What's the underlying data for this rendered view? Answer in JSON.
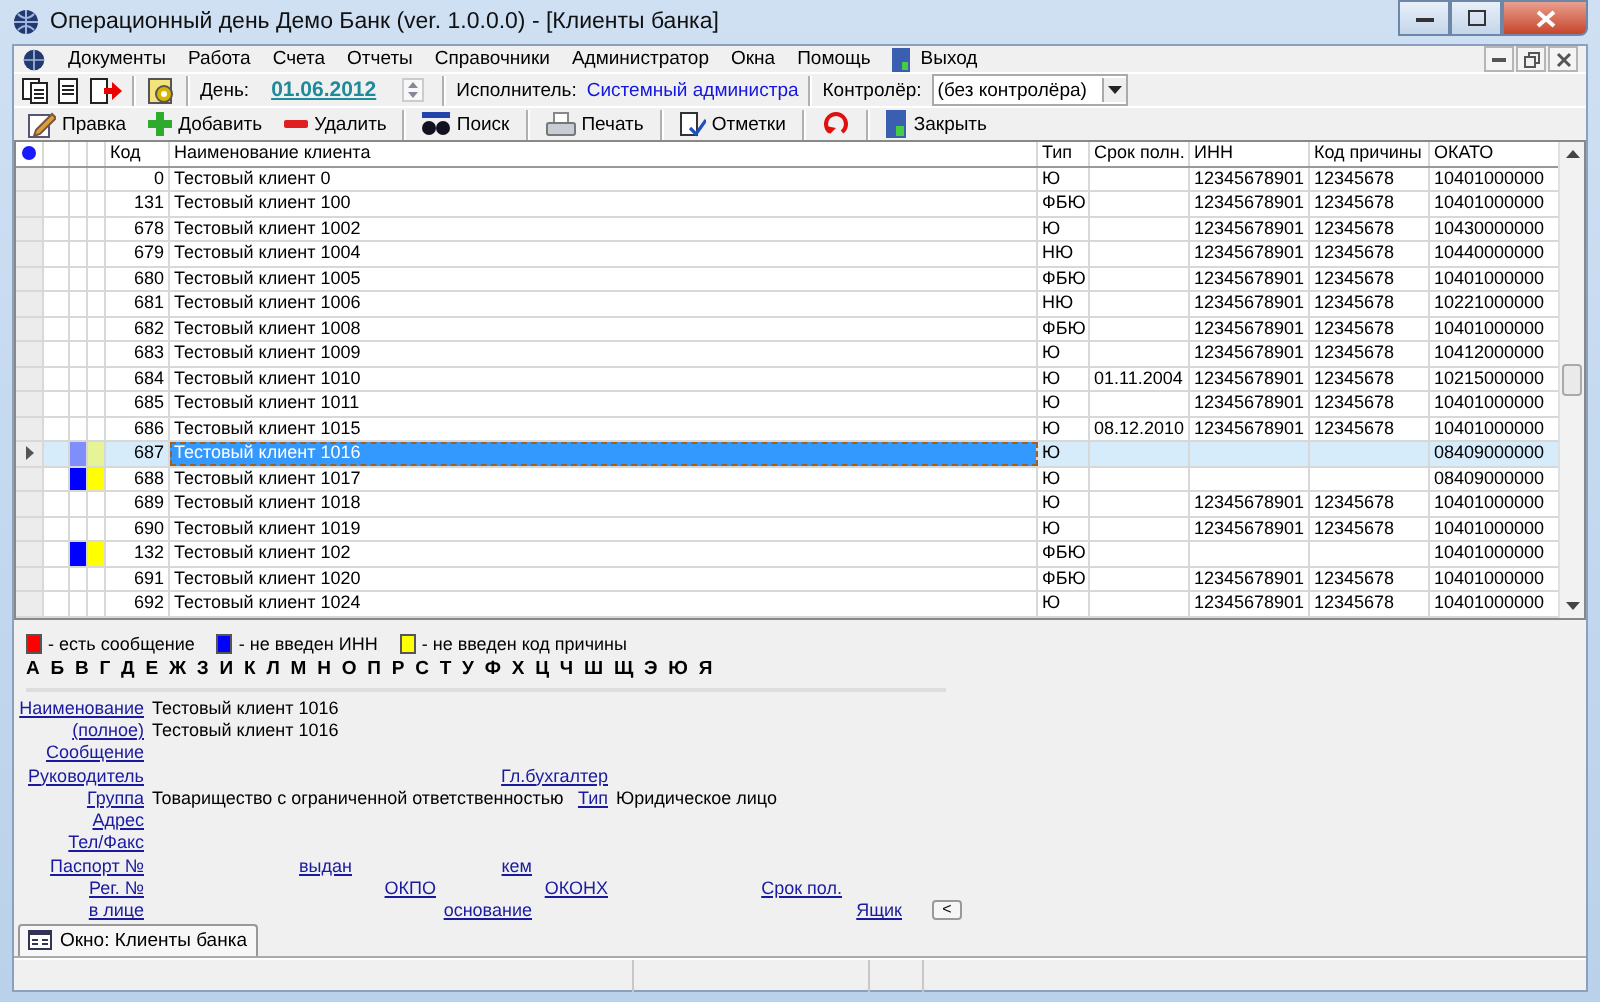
{
  "window": {
    "title": "Операционный день Демо Банк (ver. 1.0.0.0) - [Клиенты банка]"
  },
  "menu": [
    "Документы",
    "Работа",
    "Счета",
    "Отчеты",
    "Справочники",
    "Администратор",
    "Окна",
    "Помощь"
  ],
  "exit_item": "Выход",
  "toolbar": {
    "day_label": "День:",
    "date": "01.06.2012",
    "executor_label": "Исполнитель:",
    "executor": "Системный администра",
    "controller_label": "Контролёр:",
    "controller": "(без контролёра)"
  },
  "actions": [
    {
      "kind": "edit",
      "label": "Правка"
    },
    {
      "kind": "add",
      "label": "Добавить"
    },
    {
      "kind": "delete",
      "label": "Удалить"
    },
    {
      "kind": "search",
      "label": "Поиск"
    },
    {
      "kind": "print",
      "label": "Печать"
    },
    {
      "kind": "marks",
      "label": "Отметки"
    },
    {
      "kind": "refresh"
    },
    {
      "kind": "close",
      "label": "Закрыть"
    }
  ],
  "table": {
    "columns": [
      "Код",
      "Наименование клиента",
      "Тип",
      "Срок полн.",
      "ИНН",
      "Код причины",
      "ОКАТО"
    ],
    "rows": [
      {
        "code": "0",
        "name": "Тестовый клиент 0",
        "type": "Ю",
        "term": "",
        "inn": "12345678901",
        "kpp": "12345678",
        "okato": "10401000000",
        "no_inn": false,
        "no_kpp": false,
        "selected": false
      },
      {
        "code": "131",
        "name": "Тестовый клиент 100",
        "type": "ФБЮ",
        "term": "",
        "inn": "12345678901",
        "kpp": "12345678",
        "okato": "10401000000",
        "no_inn": false,
        "no_kpp": false,
        "selected": false
      },
      {
        "code": "678",
        "name": "Тестовый клиент 1002",
        "type": "Ю",
        "term": "",
        "inn": "12345678901",
        "kpp": "12345678",
        "okato": "10430000000",
        "no_inn": false,
        "no_kpp": false,
        "selected": false
      },
      {
        "code": "679",
        "name": "Тестовый клиент 1004",
        "type": "НЮ",
        "term": "",
        "inn": "12345678901",
        "kpp": "12345678",
        "okato": "10440000000",
        "no_inn": false,
        "no_kpp": false,
        "selected": false
      },
      {
        "code": "680",
        "name": "Тестовый клиент 1005",
        "type": "ФБЮ",
        "term": "",
        "inn": "12345678901",
        "kpp": "12345678",
        "okato": "10401000000",
        "no_inn": false,
        "no_kpp": false,
        "selected": false
      },
      {
        "code": "681",
        "name": "Тестовый клиент 1006",
        "type": "НЮ",
        "term": "",
        "inn": "12345678901",
        "kpp": "12345678",
        "okato": "10221000000",
        "no_inn": false,
        "no_kpp": false,
        "selected": false
      },
      {
        "code": "682",
        "name": "Тестовый клиент 1008",
        "type": "ФБЮ",
        "term": "",
        "inn": "12345678901",
        "kpp": "12345678",
        "okato": "10401000000",
        "no_inn": false,
        "no_kpp": false,
        "selected": false
      },
      {
        "code": "683",
        "name": "Тестовый клиент 1009",
        "type": "Ю",
        "term": "",
        "inn": "12345678901",
        "kpp": "12345678",
        "okato": "10412000000",
        "no_inn": false,
        "no_kpp": false,
        "selected": false
      },
      {
        "code": "684",
        "name": "Тестовый клиент 1010",
        "type": "Ю",
        "term": "01.11.2004",
        "inn": "12345678901",
        "kpp": "12345678",
        "okato": "10215000000",
        "no_inn": false,
        "no_kpp": false,
        "selected": false
      },
      {
        "code": "685",
        "name": "Тестовый клиент 1011",
        "type": "Ю",
        "term": "",
        "inn": "12345678901",
        "kpp": "12345678",
        "okato": "10401000000",
        "no_inn": false,
        "no_kpp": false,
        "selected": false
      },
      {
        "code": "686",
        "name": "Тестовый клиент 1015",
        "type": "Ю",
        "term": "08.12.2010",
        "inn": "12345678901",
        "kpp": "12345678",
        "okato": "10401000000",
        "no_inn": false,
        "no_kpp": false,
        "selected": false
      },
      {
        "code": "687",
        "name": "Тестовый клиент 1016",
        "type": "Ю",
        "term": "",
        "inn": "",
        "kpp": "",
        "okato": "08409000000",
        "no_inn": true,
        "no_kpp": true,
        "selected": true
      },
      {
        "code": "688",
        "name": "Тестовый клиент 1017",
        "type": "Ю",
        "term": "",
        "inn": "",
        "kpp": "",
        "okato": "08409000000",
        "no_inn": true,
        "no_kpp": true,
        "selected": false
      },
      {
        "code": "689",
        "name": "Тестовый клиент 1018",
        "type": "Ю",
        "term": "",
        "inn": "12345678901",
        "kpp": "12345678",
        "okato": "10401000000",
        "no_inn": false,
        "no_kpp": false,
        "selected": false
      },
      {
        "code": "690",
        "name": "Тестовый клиент 1019",
        "type": "Ю",
        "term": "",
        "inn": "12345678901",
        "kpp": "12345678",
        "okato": "10401000000",
        "no_inn": false,
        "no_kpp": false,
        "selected": false
      },
      {
        "code": "132",
        "name": "Тестовый клиент 102",
        "type": "ФБЮ",
        "term": "",
        "inn": "",
        "kpp": "",
        "okato": "10401000000",
        "no_inn": true,
        "no_kpp": true,
        "selected": false
      },
      {
        "code": "691",
        "name": "Тестовый клиент 1020",
        "type": "ФБЮ",
        "term": "",
        "inn": "12345678901",
        "kpp": "12345678",
        "okato": "10401000000",
        "no_inn": false,
        "no_kpp": false,
        "selected": false
      },
      {
        "code": "692",
        "name": "Тестовый клиент 1024",
        "type": "Ю",
        "term": "",
        "inn": "12345678901",
        "kpp": "12345678",
        "okato": "10401000000",
        "no_inn": false,
        "no_kpp": false,
        "selected": false
      }
    ]
  },
  "legend": [
    {
      "color": "#ff0000",
      "text": "- есть сообщение"
    },
    {
      "color": "#0000ff",
      "text": "- не введен ИНН"
    },
    {
      "color": "#ffff00",
      "text": "- не введен код причины"
    }
  ],
  "alphabet": [
    "А",
    "Б",
    "В",
    "Г",
    "Д",
    "Е",
    "Ж",
    "З",
    "И",
    "К",
    "Л",
    "М",
    "Н",
    "О",
    "П",
    "Р",
    "С",
    "Т",
    "У",
    "Ф",
    "Х",
    "Ц",
    "Ч",
    "Ш",
    "Щ",
    "Э",
    "Ю",
    "Я"
  ],
  "details": [
    [
      {
        "kind": "link",
        "text": "Наименование"
      },
      {
        "kind": "value",
        "text": "Тестовый клиент 1016"
      }
    ],
    [
      {
        "kind": "link",
        "text": "(полное)"
      },
      {
        "kind": "value",
        "text": "Тестовый клиент 1016"
      }
    ],
    [
      {
        "kind": "link",
        "text": "Сообщение"
      }
    ],
    [
      {
        "kind": "link",
        "text": "Руководитель"
      },
      {
        "kind": "link",
        "text": "Гл.бухгалтер"
      }
    ],
    [
      {
        "kind": "link",
        "text": "Группа"
      },
      {
        "kind": "value",
        "text": "Товарищество с ограниченной ответственностью"
      },
      {
        "kind": "link",
        "text": "Тип"
      },
      {
        "kind": "value",
        "text": "Юридическое лицо"
      }
    ],
    [
      {
        "kind": "link",
        "text": "Адрес"
      }
    ],
    [
      {
        "kind": "link",
        "text": "Тел/Факс"
      }
    ],
    [
      {
        "kind": "link",
        "text": "Паспорт №"
      },
      {
        "kind": "link",
        "text": "выдан"
      },
      {
        "kind": "link",
        "text": "кем"
      }
    ],
    [
      {
        "kind": "link",
        "text": "Рег. №"
      },
      {
        "kind": "link",
        "text": "ОКПО"
      },
      {
        "kind": "link",
        "text": "ОКОНХ"
      },
      {
        "kind": "link",
        "text": "Срок пол."
      }
    ],
    [
      {
        "kind": "link",
        "text": "в лице"
      },
      {
        "kind": "link",
        "text": "основание"
      },
      {
        "kind": "link",
        "text": "Ящик"
      },
      {
        "kind": "button",
        "text": "<"
      }
    ]
  ],
  "tabs": [
    {
      "label": "Окно: Клиенты банка",
      "selected": true
    }
  ]
}
